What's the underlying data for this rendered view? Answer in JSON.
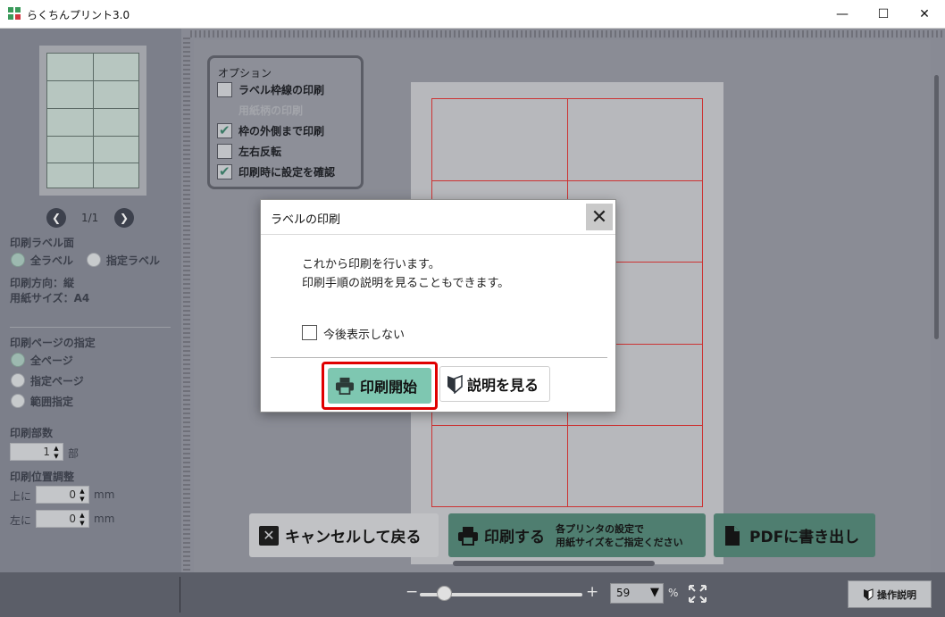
{
  "window": {
    "title": "らくちんプリント3.0",
    "minimize": "—",
    "maximize": "☐",
    "close": "✕"
  },
  "left": {
    "pager": "1/1",
    "label_side_title": "印刷ラベル面",
    "label_side_options": [
      "全ラベル",
      "指定ラベル"
    ],
    "label_side_selected": "全ラベル",
    "orientation": "印刷方向：縦",
    "paper_size": "用紙サイズ：A4",
    "page_spec_title": "印刷ページの指定",
    "page_spec_options": [
      "全ページ",
      "指定ページ",
      "範囲指定"
    ],
    "page_spec_selected": "全ページ",
    "copies_title": "印刷部数",
    "copies_value": "1",
    "copies_unit": "部",
    "offset_title": "印刷位置調整",
    "top_label": "上に",
    "top_value": "0",
    "left_label": "左に",
    "left_value": "0",
    "mm": "mm"
  },
  "options": {
    "title": "オプション",
    "items": [
      {
        "label": "ラベル枠線の印刷",
        "checked": false,
        "disabled": false
      },
      {
        "label": "用紙柄の印刷",
        "checked": false,
        "disabled": true
      },
      {
        "label": "枠の外側まで印刷",
        "checked": true,
        "disabled": false
      },
      {
        "label": "左右反転",
        "checked": false,
        "disabled": false
      },
      {
        "label": "印刷時に設定を確認",
        "checked": true,
        "disabled": false
      }
    ]
  },
  "actions": {
    "cancel": "キャンセルして戻る",
    "print": "印刷する",
    "print_note_1": "各プリンタの設定で",
    "print_note_2": "用紙サイズをご指定ください",
    "pdf": "PDFに書き出し"
  },
  "footer": {
    "zoom_minus": "−",
    "zoom_plus": "+",
    "zoom_value": "59",
    "zoom_level": 0.15,
    "percent": "%",
    "help": "操作説明"
  },
  "dialog": {
    "title": "ラベルの印刷",
    "message_1": "これから印刷を行います。",
    "message_2": "印刷手順の説明を見ることもできます。",
    "dont_show": "今後表示しない",
    "start": "印刷開始",
    "guide": "説明を見る"
  },
  "colors": {
    "accent_green": "#4f7e70",
    "highlight_red": "#e00000",
    "label_border_red": "#cc3333"
  }
}
